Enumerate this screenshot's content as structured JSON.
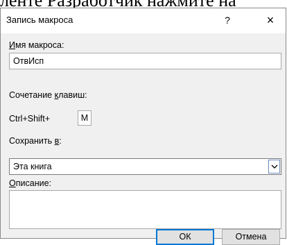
{
  "background_text": "ленте Разработчик нажмите на",
  "dialog": {
    "title": "Запись макроса",
    "help_label": "?",
    "close_label": "×"
  },
  "macro_name": {
    "label_accel": "И",
    "label_rest": "мя макроса:",
    "value": "ОтвИсп"
  },
  "shortcut": {
    "label_start": "Сочетание ",
    "label_accel": "к",
    "label_rest": "лавиш:",
    "prefix": "Ctrl+Shift+",
    "key": "М"
  },
  "store_in": {
    "label_start": "Сохранить ",
    "label_accel": "в",
    "label_rest": ":",
    "selected": "Эта книга"
  },
  "description": {
    "label_accel": "О",
    "label_rest": "писание:",
    "value": ""
  },
  "buttons": {
    "ok": "ОК",
    "cancel": "Отмена"
  }
}
